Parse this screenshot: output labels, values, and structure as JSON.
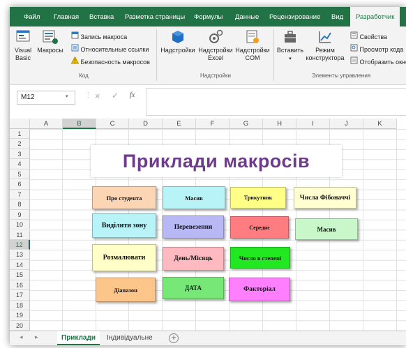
{
  "ribbon_tabs": [
    "Файл",
    "Главная",
    "Вставка",
    "Разметка страницы",
    "Формулы",
    "Данные",
    "Рецензирование",
    "Вид",
    "Разработчик"
  ],
  "ribbon": {
    "code": {
      "visual_basic": "Visual Basic",
      "macros": "Макросы",
      "record": "Запись макроса",
      "relative": "Относительные ссылки",
      "security": "Безопасность макросов",
      "group": "Код"
    },
    "addins": {
      "addins": "Надстройки",
      "excel_addins": "Надстройки Excel",
      "com_addins": "Надстройки COM",
      "group": "Надстройки"
    },
    "controls": {
      "insert": "Вставить",
      "design_mode": "Режим конструктора",
      "properties": "Свойства",
      "view_code": "Просмотр кода",
      "run_dialog": "Отобразить окно",
      "group": "Элементы управления"
    }
  },
  "formula_bar": {
    "name_box": "M12",
    "fx": "fx",
    "content": ""
  },
  "columns": [
    "A",
    "B",
    "C",
    "D",
    "E",
    "F",
    "G",
    "H",
    "I",
    "J",
    "K"
  ],
  "selected_column": "B",
  "rows": [
    "1",
    "2",
    "3",
    "4",
    "5",
    "6",
    "7",
    "8",
    "9",
    "10",
    "11",
    "12",
    "13",
    "14",
    "15",
    "16",
    "17",
    "18",
    "19",
    "20"
  ],
  "selected_row": "12",
  "sheet_title": "Приклади макросів",
  "macro_buttons": [
    {
      "label": "Про студента",
      "color": "#fcd5b5"
    },
    {
      "label": "Масив",
      "color": "#b7f3f7"
    },
    {
      "label": "Трикутник",
      "color": "#ffff88"
    },
    {
      "label": "Числа Фібоначчі",
      "color": "#ffffd1"
    },
    {
      "label": "Виділити зону",
      "color": "#b7f3f7"
    },
    {
      "label": "Перевезення",
      "color": "#b8b8f5"
    },
    {
      "label": "Середнє",
      "color": "#ff7c80"
    },
    {
      "label": "Масив",
      "color": "#c9f7c9"
    },
    {
      "label": "Розмалювати",
      "color": "#ffffc7"
    },
    {
      "label": "День/Місяць",
      "color": "#ffb9c0"
    },
    {
      "label": "Число в степені",
      "color": "#22e822"
    },
    {
      "label": "Діапазон",
      "color": "#fcc58a"
    },
    {
      "label": "ДАТА",
      "color": "#77e877"
    },
    {
      "label": "Факторіал",
      "color": "#ff7fff"
    }
  ],
  "sheet_tabs": [
    "Приклади",
    "Індивідуальне"
  ],
  "active_sheet": "Приклади",
  "accent_color": "#217346"
}
